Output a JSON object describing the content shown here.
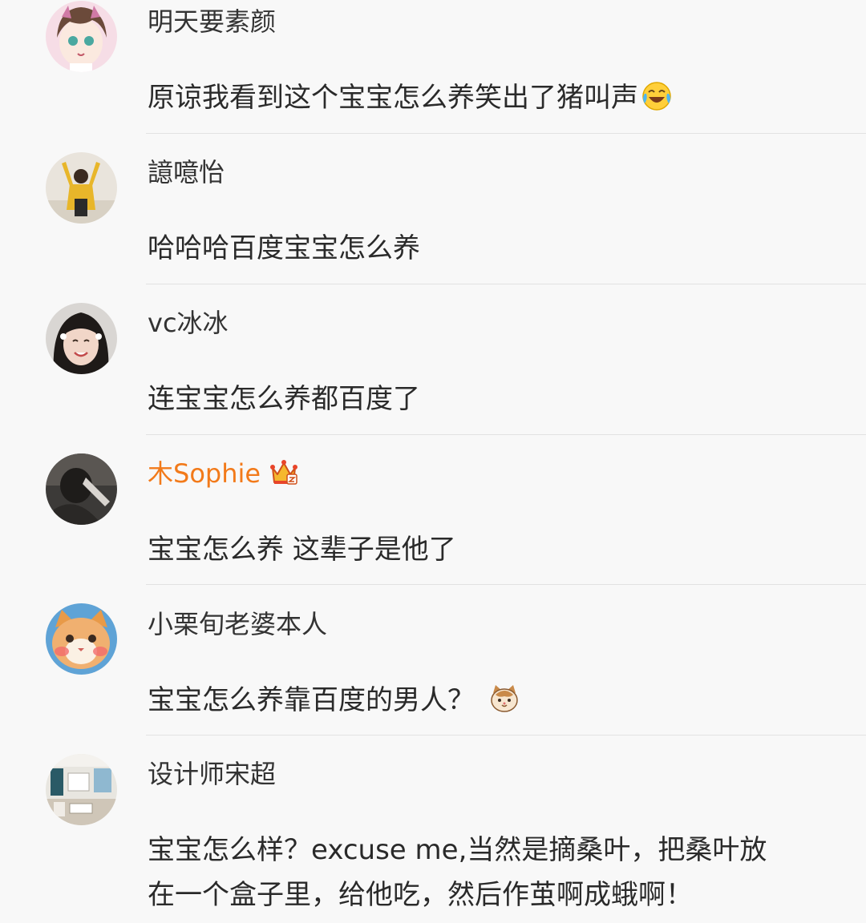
{
  "comments": [
    {
      "username": "明天要素颜",
      "text": "原谅我看到这个宝宝怎么养笑出了猪叫声",
      "emoji": "laughing-crying-emoji"
    },
    {
      "username": "譩噫怡",
      "text": "哈哈哈百度宝宝怎么养"
    },
    {
      "username": "vc冰冰",
      "text": "连宝宝怎么养都百度了"
    },
    {
      "username": "木Sophie",
      "username_color": "#f27a1a",
      "badge": "crown-icon",
      "text": "宝宝怎么养 这辈子是他了"
    },
    {
      "username": "小栗旬老婆本人",
      "text": "宝宝怎么养靠百度的男人？",
      "emoji": "cat-face-emoji"
    },
    {
      "username": "设计师宋超",
      "text_lines": [
        "宝宝怎么样？excuse me,当然是摘桑叶，把桑叶放",
        "在一个盒子里，给他吃，然后作茧啊成蛾啊！"
      ]
    }
  ],
  "colors": {
    "background": "#f8f8f8",
    "username": "#333333",
    "vip_username": "#f27a1a",
    "divider": "#e2e2e2"
  }
}
